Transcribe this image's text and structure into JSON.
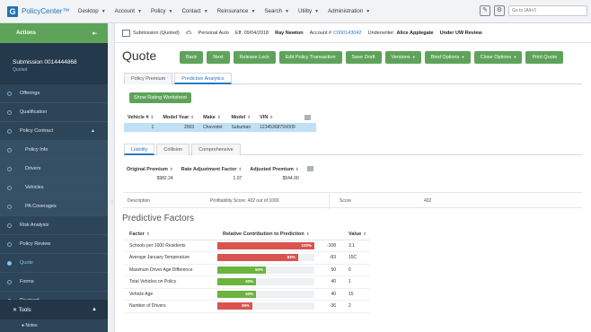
{
  "app": {
    "name": "PolicyCenter™"
  },
  "menu": [
    {
      "label": "Desktop"
    },
    {
      "label": "Account"
    },
    {
      "label": "Policy"
    },
    {
      "label": "Contact"
    },
    {
      "label": "Reinsurance"
    },
    {
      "label": "Search"
    },
    {
      "label": "Utility"
    },
    {
      "label": "Administration"
    }
  ],
  "search": {
    "placeholder": "Go to (Alt+/)"
  },
  "sidebar": {
    "actions_label": "Actions",
    "submission_title": "Submission 0014444868",
    "submission_status": "Quoted",
    "items": [
      {
        "label": "Offerings"
      },
      {
        "label": "Qualification"
      },
      {
        "label": "Policy Contract"
      },
      {
        "label": "Policy Info"
      },
      {
        "label": "Drivers"
      },
      {
        "label": "Vehicles"
      },
      {
        "label": "PA Coverages"
      },
      {
        "label": "Risk Analysis"
      },
      {
        "label": "Policy Review"
      },
      {
        "label": "Quote"
      },
      {
        "label": "Forms"
      },
      {
        "label": "Payment"
      }
    ],
    "tools_label": "Tools",
    "notes_label": "Notes"
  },
  "infobar": {
    "submission": "Submission (Quoted)",
    "product": "Personal Auto",
    "effective": "Eff. 09/04/2018",
    "insured": "Ray Newton",
    "account_label": "Account #",
    "account_number": "C000143042",
    "underwriter_label": "Underwriter:",
    "underwriter": "Alice Applegate",
    "review_status": "Under UW Review"
  },
  "page": {
    "title": "Quote"
  },
  "toolbar": [
    {
      "label": "Back",
      "caret": ""
    },
    {
      "label": "Next",
      "caret": ""
    },
    {
      "label": "Release Lock",
      "caret": ""
    },
    {
      "label": "Edit Policy Transaction",
      "caret": ""
    },
    {
      "label": "Save Draft",
      "caret": ""
    },
    {
      "label": "Versions",
      "caret": "▾"
    },
    {
      "label": "Bind Options",
      "caret": "▾"
    },
    {
      "label": "Close Options",
      "caret": "▾"
    },
    {
      "label": "Print Quote",
      "caret": ""
    }
  ],
  "tabs_main": [
    {
      "label": "Policy Premium"
    },
    {
      "label": "Predictive Analytics"
    }
  ],
  "worksheet_button": "Show Rating Worksheet",
  "vehicle_table": {
    "headers": [
      "Vehicle #",
      "Model Year",
      "Make",
      "Model",
      "VIN"
    ],
    "rows": [
      [
        "1",
        "2003",
        "Chevrolet",
        "Suburban",
        "1234536879X009"
      ]
    ]
  },
  "tabs_coverage": [
    {
      "label": "Liability"
    },
    {
      "label": "Collision"
    },
    {
      "label": "Comprehensive"
    }
  ],
  "premium_table": {
    "headers": [
      "Original Premium",
      "Rate Adjustment Factor",
      "Adjusted Premium"
    ],
    "rows": [
      [
        "$982.24",
        "1.07",
        "$544.00"
      ]
    ]
  },
  "description": {
    "label": "Description",
    "text": "Profitability Score: 402 out of 1000",
    "score_label": "Score",
    "score_value": "402"
  },
  "predictive_factors": {
    "title": "Predictive Factors",
    "headers": [
      "Factor",
      "Relative Contribution to Prediction",
      "Value"
    ],
    "rows": [
      {
        "factor": "Schools per 1000 Residents",
        "percent": 100,
        "label": "100%",
        "color": "#d9534f",
        "contribution": "-108",
        "value": "3.1"
      },
      {
        "factor": "Average January Temperature",
        "percent": 83,
        "label": "83%",
        "color": "#d9534f",
        "contribution": "-83",
        "value": "15C"
      },
      {
        "factor": "Maximum Driver Age Difference",
        "percent": 50,
        "label": "50%",
        "color": "#6db33f",
        "contribution": "50",
        "value": "0"
      },
      {
        "factor": "Total Vehicles on Policy",
        "percent": 40,
        "label": "40%",
        "color": "#6db33f",
        "contribution": "40",
        "value": "1"
      },
      {
        "factor": "Vehicle Age",
        "percent": 40,
        "label": "40%",
        "color": "#6db33f",
        "contribution": "40",
        "value": "15"
      },
      {
        "factor": "Number of Drivers",
        "percent": 36,
        "label": "36%",
        "color": "#d9534f",
        "contribution": "-36",
        "value": "2"
      }
    ]
  }
}
